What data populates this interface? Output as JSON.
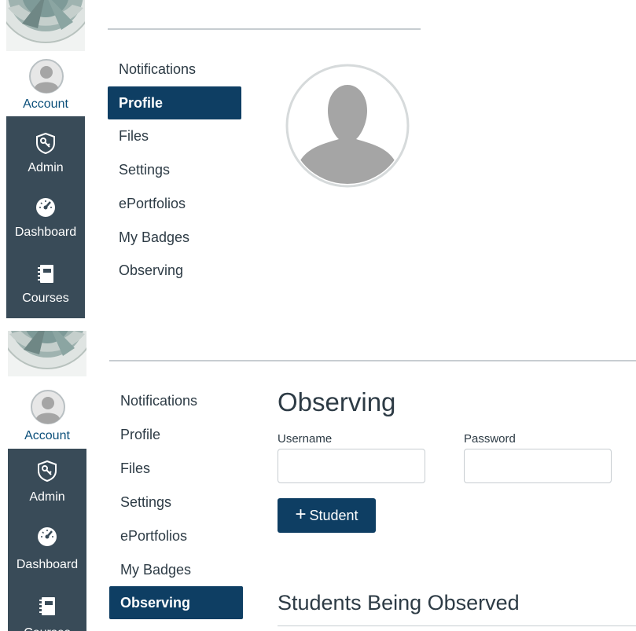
{
  "global_nav": {
    "account": "Account",
    "admin": "Admin",
    "dashboard": "Dashboard",
    "courses": "Courses"
  },
  "account_menu": {
    "items": [
      "Notifications",
      "Profile",
      "Files",
      "Settings",
      "ePortfolios",
      "My Badges",
      "Observing"
    ]
  },
  "observing": {
    "title": "Observing",
    "username_label": "Username",
    "password_label": "Password",
    "add_button_icon": "+",
    "add_button_label": "Student",
    "section_title": "Students Being Observed"
  },
  "icons": {
    "admin": "shield-key-icon",
    "dashboard": "speedometer-icon",
    "courses": "notebook-icon",
    "account": "user-avatar-icon"
  },
  "colors": {
    "nav_bg": "#394b58",
    "active_bg": "#0e3e63",
    "account_text": "#0b4f7a"
  }
}
